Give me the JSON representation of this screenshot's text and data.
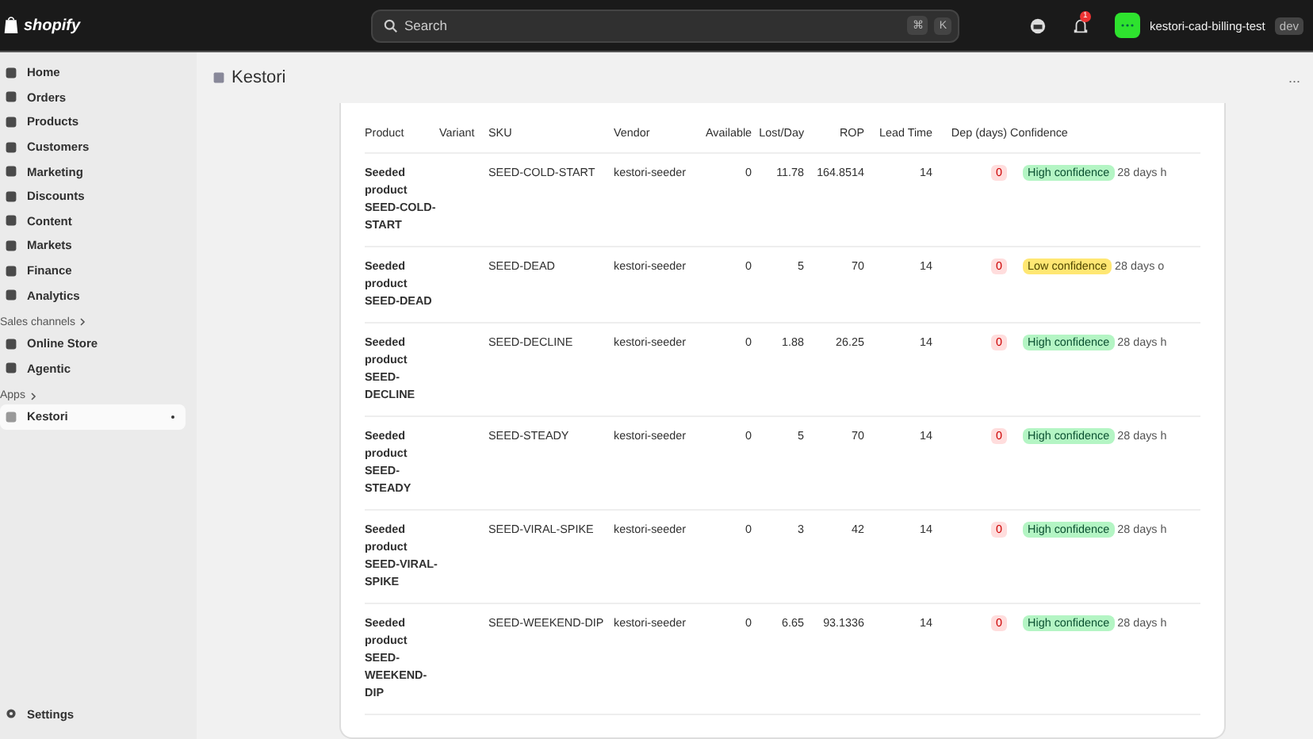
{
  "topbar": {
    "logo": "shopify",
    "search": {
      "placeholder": "Search",
      "keys": [
        "⌘",
        "K"
      ]
    },
    "notification_count": "1",
    "store": "kestori-cad-billing-test",
    "store_badge": "dev"
  },
  "sidebar": {
    "items": [
      {
        "label": "Home",
        "selected": false
      },
      {
        "label": "Orders",
        "selected": false
      },
      {
        "label": "Products",
        "selected": false
      },
      {
        "label": "Customers",
        "selected": false
      },
      {
        "label": "Marketing",
        "selected": false
      },
      {
        "label": "Discounts",
        "selected": false
      },
      {
        "label": "Content",
        "selected": false
      },
      {
        "label": "Markets",
        "selected": false
      },
      {
        "label": "Finance",
        "selected": false
      },
      {
        "label": "Analytics",
        "selected": false
      }
    ],
    "sections": [
      {
        "title": "Sales channels",
        "items": [
          {
            "label": "Online Store",
            "selected": false
          },
          {
            "label": "Agentic",
            "selected": false
          }
        ]
      },
      {
        "title": "Apps",
        "items": [
          {
            "label": "Kestori",
            "selected": true
          }
        ]
      }
    ],
    "footer": {
      "label": "Settings"
    }
  },
  "page": {
    "title": "Kestori",
    "more": "..."
  },
  "table": {
    "columns": [
      "Product",
      "Variant",
      "SKU",
      "Vendor",
      "Available",
      "Lost/Day",
      "ROP",
      "Lead Time",
      "Dep (days)",
      "Confidence"
    ],
    "rows": [
      {
        "product": "Seeded product SEED-COLD-START",
        "sku": "SEED-COLD-START",
        "vendor": "kestori-seeder",
        "available": "0",
        "lost_day": "11.78",
        "rop": "164.8514",
        "lead_time": "14",
        "dep": "0",
        "confidence": {
          "kind": "high",
          "label": "High confidence"
        },
        "note": "28 days h"
      },
      {
        "product": "Seeded product SEED-DEAD",
        "sku": "SEED-DEAD",
        "vendor": "kestori-seeder",
        "available": "0",
        "lost_day": "5",
        "rop": "70",
        "lead_time": "14",
        "dep": "0",
        "confidence": {
          "kind": "low",
          "label": "Low confidence"
        },
        "note": "28 days o"
      },
      {
        "product": "Seeded product SEED-DECLINE",
        "sku": "SEED-DECLINE",
        "vendor": "kestori-seeder",
        "available": "0",
        "lost_day": "1.88",
        "rop": "26.25",
        "lead_time": "14",
        "dep": "0",
        "confidence": {
          "kind": "high",
          "label": "High confidence"
        },
        "note": "28 days h"
      },
      {
        "product": "Seeded product SEED-STEADY",
        "sku": "SEED-STEADY",
        "vendor": "kestori-seeder",
        "available": "0",
        "lost_day": "5",
        "rop": "70",
        "lead_time": "14",
        "dep": "0",
        "confidence": {
          "kind": "high",
          "label": "High confidence"
        },
        "note": "28 days h"
      },
      {
        "product": "Seeded product SEED-VIRAL-SPIKE",
        "sku": "SEED-VIRAL-SPIKE",
        "vendor": "kestori-seeder",
        "available": "0",
        "lost_day": "3",
        "rop": "42",
        "lead_time": "14",
        "dep": "0",
        "confidence": {
          "kind": "high",
          "label": "High confidence"
        },
        "note": "28 days h"
      },
      {
        "product": "Seeded product SEED-WEEKEND-DIP",
        "sku": "SEED-WEEKEND-DIP",
        "vendor": "kestori-seeder",
        "available": "0",
        "lost_day": "6.65",
        "rop": "93.1336",
        "lead_time": "14",
        "dep": "0",
        "confidence": {
          "kind": "high",
          "label": "High confidence"
        },
        "note": "28 days h"
      }
    ]
  }
}
